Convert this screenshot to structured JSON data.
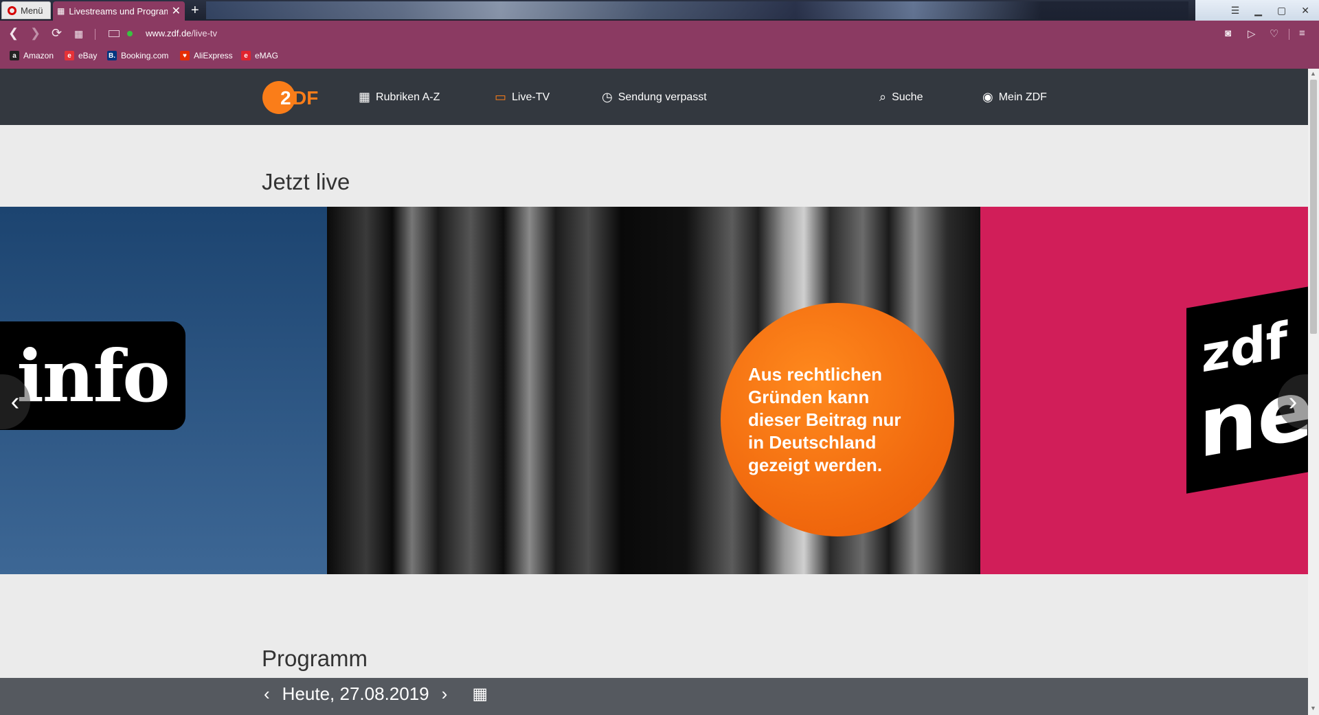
{
  "browser": {
    "menu_label": "Menü",
    "tab_title": "Livestreams und Programm",
    "url_domain": "www.zdf.de",
    "url_path": "/live-tv",
    "bookmarks": [
      {
        "label": "Amazon",
        "icon": "amazon-icon",
        "color": "#222222",
        "glyph": "a"
      },
      {
        "label": "eBay",
        "icon": "ebay-icon",
        "color": "#e53238",
        "glyph": "e"
      },
      {
        "label": "Booking.com",
        "icon": "booking-icon",
        "color": "#003580",
        "glyph": "B."
      },
      {
        "label": "AliExpress",
        "icon": "aliexpress-icon",
        "color": "#e62e04",
        "glyph": "♥"
      },
      {
        "label": "eMAG",
        "icon": "emag-icon",
        "color": "#e0242e",
        "glyph": "e"
      }
    ],
    "accent": "#8b3a62"
  },
  "nav": {
    "items": [
      {
        "label": "Rubriken A-Z",
        "icon": "grid-icon"
      },
      {
        "label": "Live-TV",
        "icon": "tv-icon"
      },
      {
        "label": "Sendung verpasst",
        "icon": "clock-icon"
      },
      {
        "label": "Suche",
        "icon": "search-icon"
      },
      {
        "label": "Mein ZDF",
        "icon": "user-icon"
      }
    ],
    "logo": "ZDF",
    "brand_color": "#fa7d19"
  },
  "main": {
    "live_title": "Jetzt live",
    "slides": [
      {
        "channel": "zdfinfo",
        "logo_text": "info",
        "color": "#2b5683"
      },
      {
        "channel": "zdf",
        "notice": "Aus rechtlichen\nGründen kann\ndieser Beitrag nur\nin Deutschland\ngezeigt werden.",
        "color": "#f26b0f"
      },
      {
        "channel": "zdfneo",
        "logo_text_top": "zdf",
        "logo_text_bottom": "ne",
        "color": "#d11e59"
      }
    ],
    "program_title": "Programm",
    "date_label": "Heute, 27.08.2019"
  }
}
